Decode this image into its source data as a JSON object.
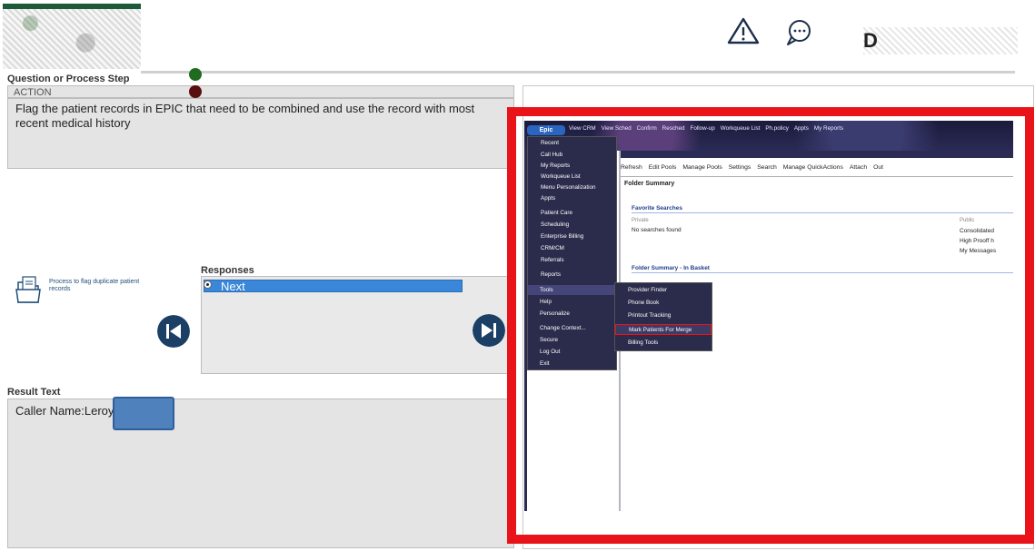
{
  "header": {
    "user_name": "D"
  },
  "left": {
    "question_label": "Question or Process Step",
    "action_label": "ACTION",
    "question_text": "Flag the patient records in EPIC that need to be combined and use the record with most recent medical history",
    "process_text": "Process to flag duplicate patient records",
    "responses_label": "Responses",
    "responses": [
      "Next"
    ],
    "result_label": "Result Text",
    "result_text": "Caller Name:Leroy"
  },
  "epic": {
    "epic_button": "Epic",
    "top_nav": [
      "View CRM",
      "View Sched",
      "Confirm",
      "Resched",
      "Follow-up",
      "Workqueue List",
      "Ph.policy",
      "Appts",
      "My Reports"
    ],
    "toolbar": [
      "Refresh",
      "Edit Pools",
      "Manage Pools",
      "Settings",
      "Search",
      "Manage QuickActions",
      "Attach",
      "Out"
    ],
    "folder_summary": "Folder Summary",
    "favorite_searches": "Favorite Searches",
    "private_label": "Private",
    "public_label": "Public",
    "no_searches": "No searches found",
    "public_items": [
      "Consolidated",
      "High Prooff h",
      "My Messages"
    ],
    "folder_summary_inbasket": "Folder Summary - In Basket",
    "menu": [
      "Recent",
      "Call Hub",
      "My Reports",
      "Workqueue List",
      "Menu Personalization",
      "Appts",
      "Patient Care",
      "Scheduling",
      "Enterprise Billing",
      "CRM/CM",
      "Referrals",
      "Reports",
      "Tools",
      "Help",
      "Personalize",
      "Change Context...",
      "Secure",
      "Log Out",
      "Exit"
    ],
    "submenu": [
      "Provider Finder",
      "Phone Book",
      "Printout Tracking",
      "Mark Patients For Merge",
      "Billing Tools"
    ]
  },
  "colors": {
    "highlight_frame": "#e8141a",
    "response_selected": "#3a86d8",
    "nav_button": "#1c3f66"
  }
}
